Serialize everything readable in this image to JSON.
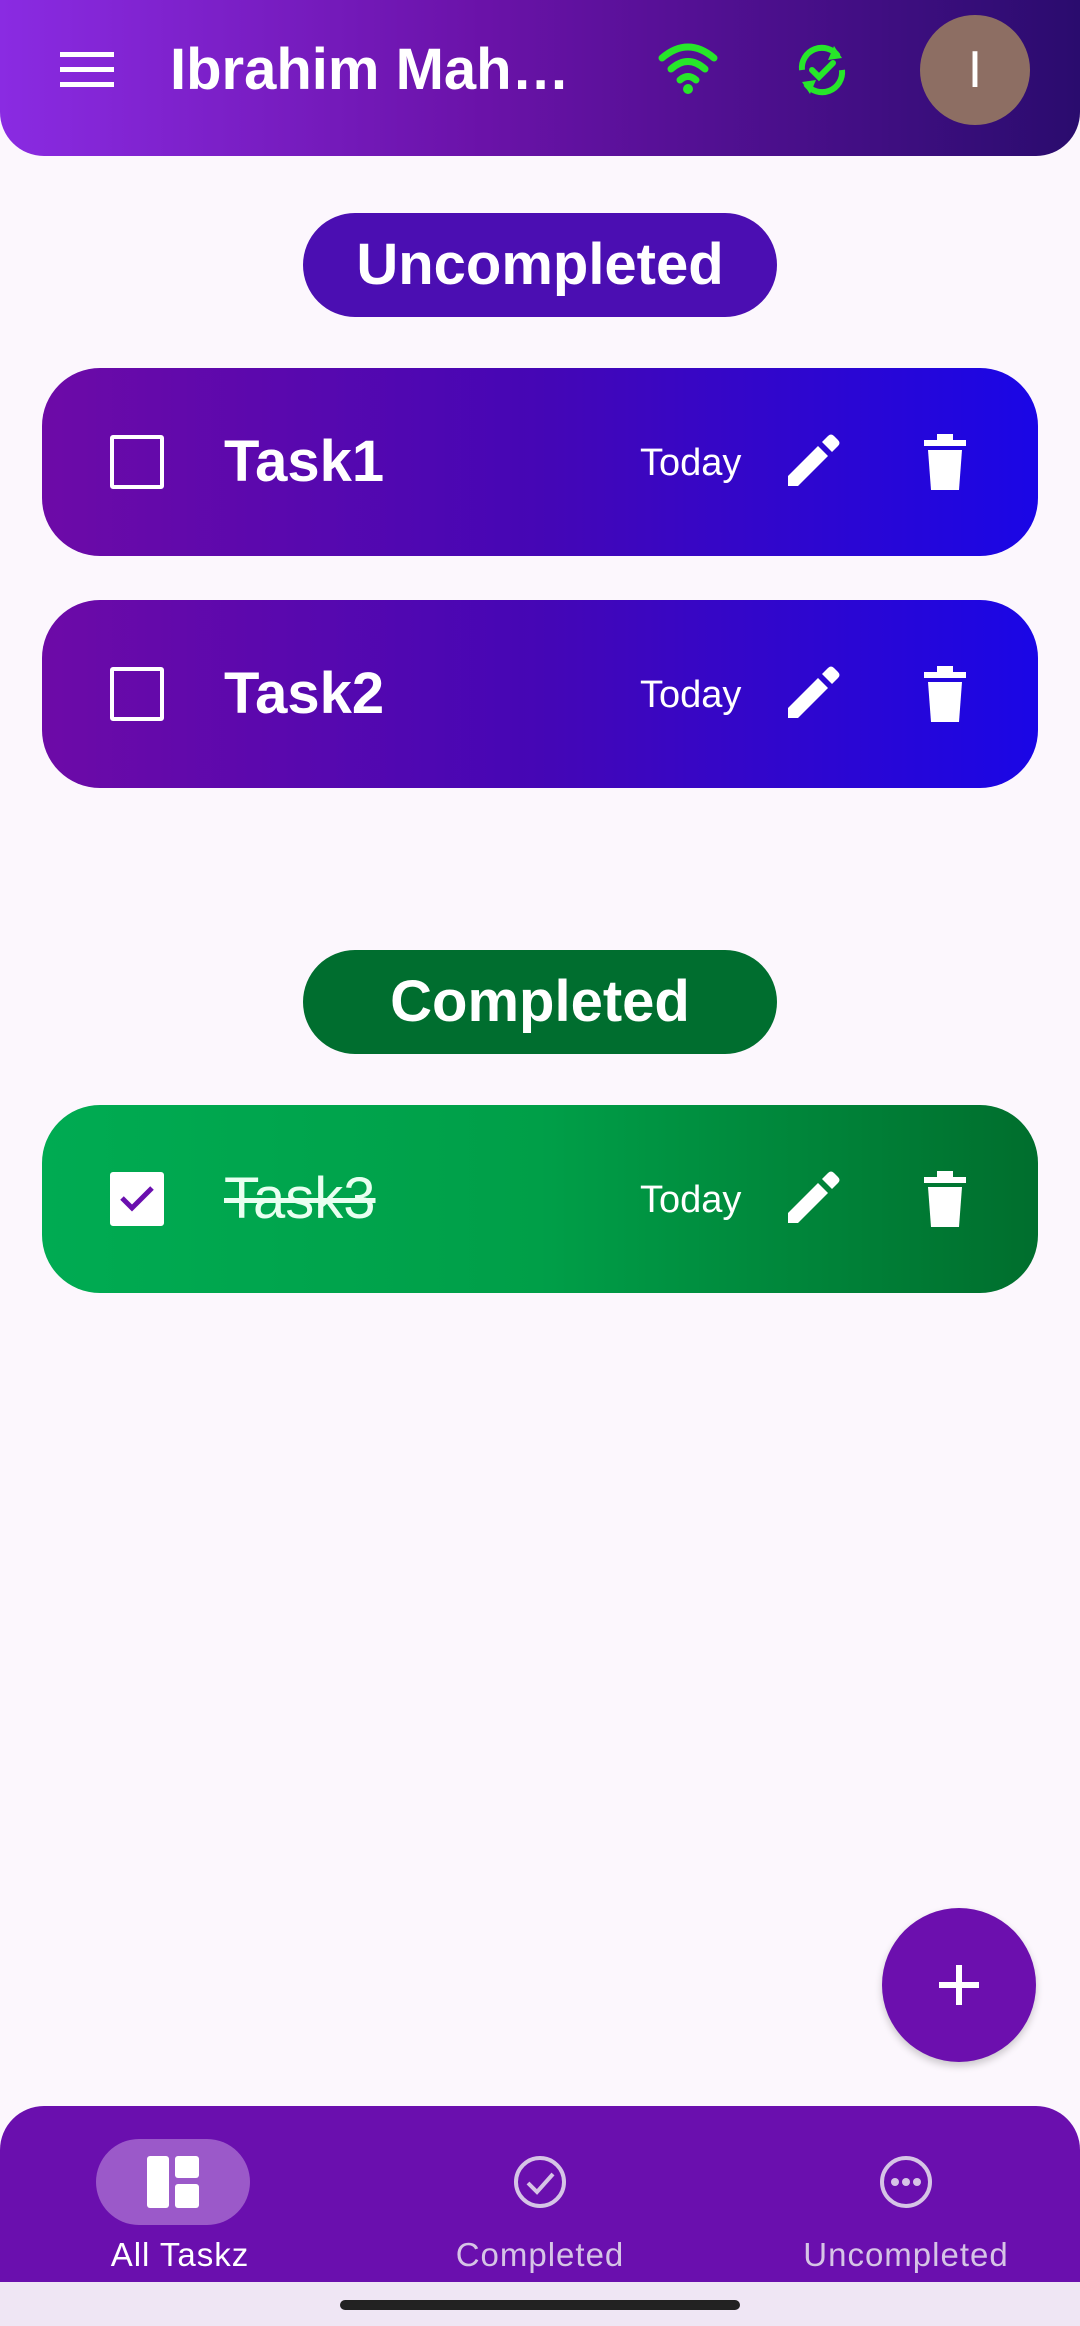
{
  "header": {
    "title": "Ibrahim Mahm...",
    "avatar_initial": "I",
    "icons": {
      "menu": "menu-icon",
      "wifi": "wifi-icon",
      "sync": "sync-done-icon"
    }
  },
  "sections": {
    "uncompleted_label": "Uncompleted",
    "completed_label": "Completed"
  },
  "tasks": [
    {
      "title": "Task1",
      "due": "Today",
      "completed": false
    },
    {
      "title": "Task2",
      "due": "Today",
      "completed": false
    },
    {
      "title": "Task3",
      "due": "Today",
      "completed": true
    }
  ],
  "fab": {
    "icon": "plus-icon"
  },
  "bottom_nav": {
    "items": [
      {
        "label": "All Taskz",
        "icon": "dashboard-icon",
        "active": true
      },
      {
        "label": "Completed",
        "icon": "check-circle-icon",
        "active": false
      },
      {
        "label": "Uncompleted",
        "icon": "more-circle-icon",
        "active": false
      }
    ]
  },
  "colors": {
    "header_start": "#8a2be2",
    "header_end": "#2a0c6e",
    "uncompleted_pill": "#4b0eb2",
    "completed_pill": "#006e2f",
    "status_green": "#27e62a",
    "nav_bg": "#6a0fae"
  }
}
